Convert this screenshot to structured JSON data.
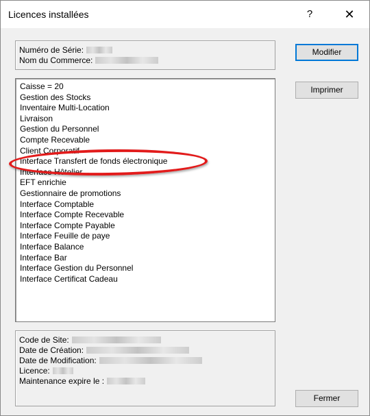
{
  "window": {
    "title": "Licences installées",
    "help_label": "?",
    "close_label": "✕"
  },
  "info_top": {
    "serial_label": "Numéro de Série:",
    "store_label": "Nom du Commerce:"
  },
  "licences": [
    "Caisse = 20",
    "Gestion des Stocks",
    "Inventaire Multi-Location",
    "Livraison",
    "Gestion du Personnel",
    "Compte Recevable",
    "Client Corporatif",
    "Interface Transfert de fonds électronique",
    "Interface Hôtelier",
    "EFT enrichie",
    "Gestionnaire de promotions",
    "Interface Comptable",
    "Interface Compte Recevable",
    "Interface Compte Payable",
    "Interface Feuille de paye",
    "Interface Balance",
    "Interface Bar",
    "Interface Gestion du Personnel",
    "Interface Certificat Cadeau"
  ],
  "info_bottom": {
    "site_code_label": "Code de Site:",
    "creation_date_label": "Date de Création:",
    "modification_date_label": "Date de Modification:",
    "licence_label": "Licence:",
    "maintenance_label": "Maintenance expire le :"
  },
  "buttons": {
    "modify": "Modifier",
    "print": "Imprimer",
    "close": "Fermer"
  },
  "colors": {
    "highlight": "#e21b1b",
    "default_button_border": "#0078d7"
  }
}
